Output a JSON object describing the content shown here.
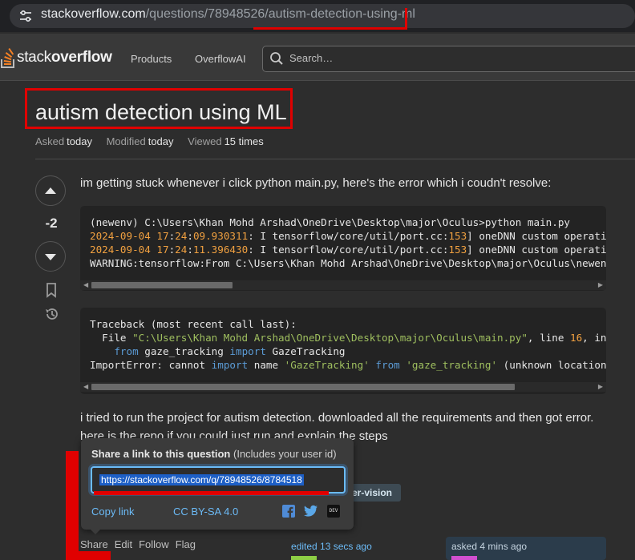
{
  "browser": {
    "url_host": "stackoverflow.com",
    "url_path": "/questions/78948526/autism-detection-using-ml"
  },
  "header": {
    "logo_prefix": "stack",
    "logo_suffix": "overflow",
    "nav": [
      "Products",
      "OverflowAI"
    ],
    "search_placeholder": "Search…"
  },
  "question": {
    "title": "autism detection using ML",
    "meta": [
      {
        "label": "Asked",
        "value": "today"
      },
      {
        "label": "Modified",
        "value": "today"
      },
      {
        "label": "Viewed",
        "value": "15 times"
      }
    ],
    "score": "-2",
    "intro": "im getting stuck whenever i click python main.py, here's the error which i coudn't resolve:",
    "outro_line1": "i tried to run the project for autism detection. downloaded all the requirements and then got error.",
    "outro_line2": "here is the repo if you could just run and explain the steps",
    "tag_visible": "er-vision",
    "actions": [
      "Share",
      "Edit",
      "Follow",
      "Flag"
    ],
    "edited": "edited 13 secs ago",
    "asked": "asked 4 mins ago"
  },
  "code_block_1": {
    "line1": "(newenv) C:\\Users\\Khan Mohd Arshad\\OneDrive\\Desktop\\major\\Oculus>python main.py",
    "line2": {
      "date": "2024-09-04 ",
      "h": "17",
      "m": "24",
      "s": "09.930311",
      "rest": ": I tensorflow/core/util/port.cc:",
      "num": "153",
      "tail": "] oneDNN custom operations are on."
    },
    "line3": {
      "date": "2024-09-04 ",
      "h": "17",
      "m": "24",
      "s": "11.396430",
      "rest": ": I tensorflow/core/util/port.cc:",
      "num": "153",
      "tail": "] oneDNN custom operations are on."
    },
    "line4": "WARNING:tensorflow:From C:\\Users\\Khan Mohd Arshad\\OneDrive\\Desktop\\major\\Oculus\\newenv\\lib",
    "scroll_fraction": 0.28
  },
  "code_block_2": {
    "line1": "Traceback (most recent call last):",
    "line2": {
      "pre": "  File ",
      "str": "\"C:\\Users\\Khan Mohd Arshad\\OneDrive\\Desktop\\major\\Oculus\\main.py\"",
      "mid": ", line ",
      "num": "16",
      "tail": ", in <module>"
    },
    "line3": {
      "pre": "    ",
      "kw1": "from",
      "mid": " gaze_tracking ",
      "kw2": "import",
      "tail": " GazeTracking"
    },
    "line4": {
      "pre": "ImportError: cannot ",
      "kw1": "import",
      "mid": " name ",
      "s1": "'GazeTracking'",
      "sp": " ",
      "kw2": "from",
      "sp2": " ",
      "s2": "'gaze_tracking'",
      "tail": " (unknown location)"
    },
    "scroll_fraction": 0.84
  },
  "share_popup": {
    "title": "Share a link to this question",
    "subtitle": "(Includes your user id)",
    "url": "https://stackoverflow.com/q/78948526/8784518",
    "copy_link": "Copy link",
    "license": "CC BY-SA 4.0",
    "social": [
      "facebook-icon",
      "twitter-icon",
      "dev-icon"
    ],
    "dev_label": "DEV"
  },
  "colors": {
    "annotation_red": "#e00000",
    "link_blue": "#6cbbf7",
    "selection_blue": "#1d5fc6"
  }
}
